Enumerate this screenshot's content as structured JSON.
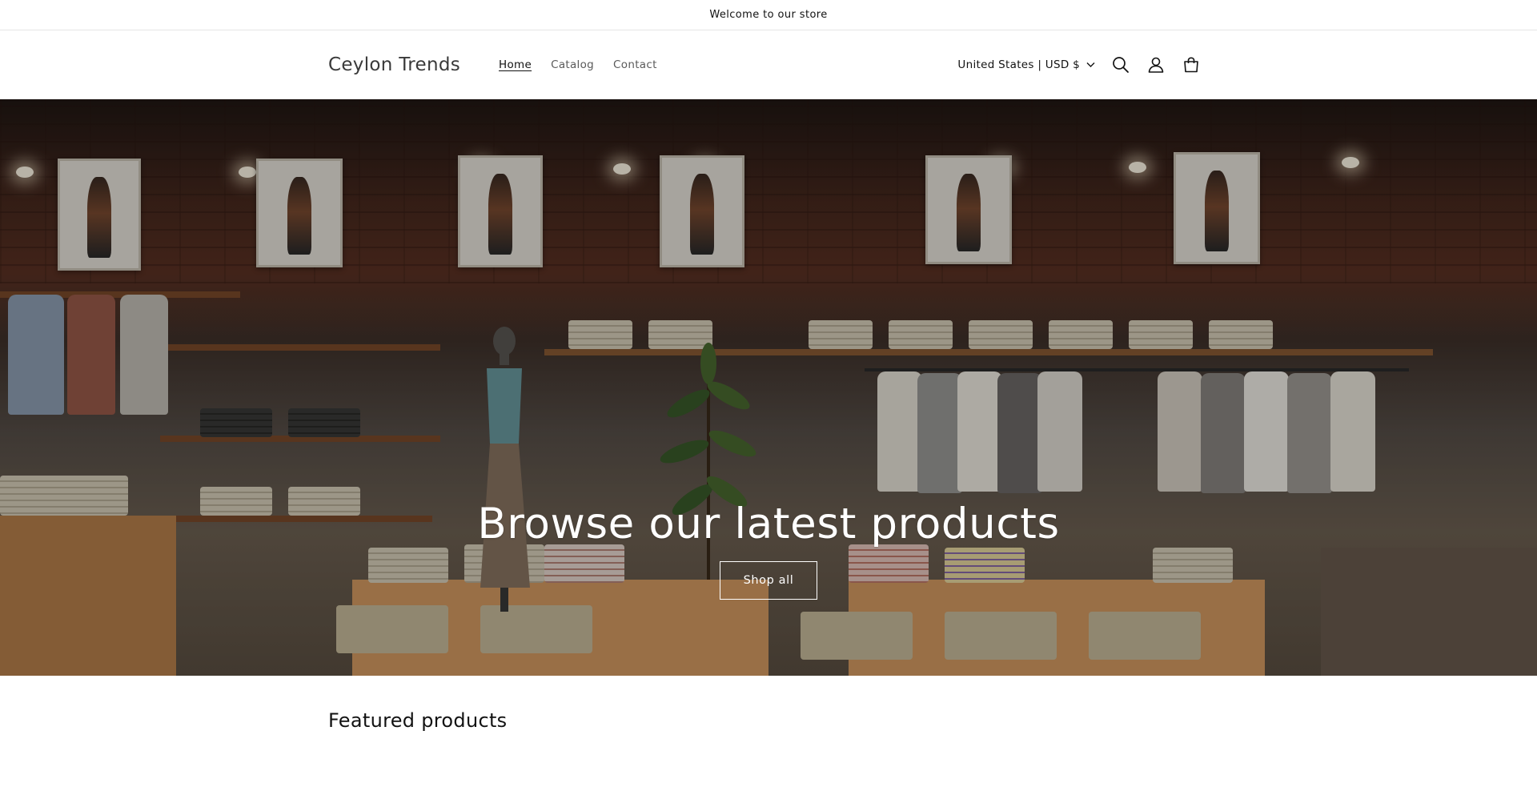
{
  "announcement": {
    "text": "Welcome to our store"
  },
  "header": {
    "logo": "Ceylon Trends",
    "nav": [
      {
        "label": "Home",
        "active": true
      },
      {
        "label": "Catalog",
        "active": false
      },
      {
        "label": "Contact",
        "active": false
      }
    ],
    "localization": "United States | USD $",
    "icons": [
      "search-icon",
      "account-icon",
      "cart-icon"
    ]
  },
  "hero": {
    "title": "Browse our latest products",
    "button_label": "Shop all"
  },
  "featured": {
    "heading": "Featured products"
  },
  "colors": {
    "text": "#121212",
    "muted": "#5a5a5a",
    "hero_text": "#ffffff"
  }
}
